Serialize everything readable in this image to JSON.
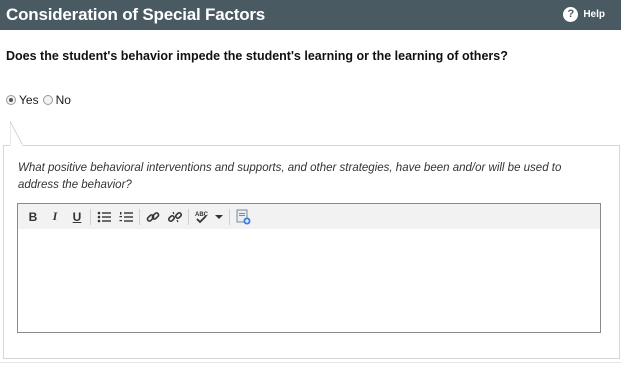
{
  "header": {
    "title": "Consideration of Special Factors",
    "help_label": "Help"
  },
  "question": "Does the student's behavior impede the student's learning or the learning of others?",
  "radio_group": {
    "options": [
      {
        "label": "Yes",
        "checked": true
      },
      {
        "label": "No",
        "checked": false
      }
    ]
  },
  "followup": {
    "prompt": "What positive behavioral interventions and supports, and other strategies, have been and/or will be used to address the behavior?",
    "editor": {
      "toolbar_icons": [
        "bold-icon",
        "italic-icon",
        "underline-icon",
        "bulleted-list-icon",
        "numbered-list-icon",
        "link-icon",
        "unlink-icon",
        "spellcheck-icon",
        "chevron-down-icon",
        "paste-icon"
      ],
      "toolbar_text": {
        "bold": "B",
        "italic": "I",
        "underline": "U",
        "spellcheck": "ABC"
      },
      "value": ""
    }
  },
  "colors": {
    "header_bg": "#4a5a63",
    "header_text": "#ffffff"
  }
}
